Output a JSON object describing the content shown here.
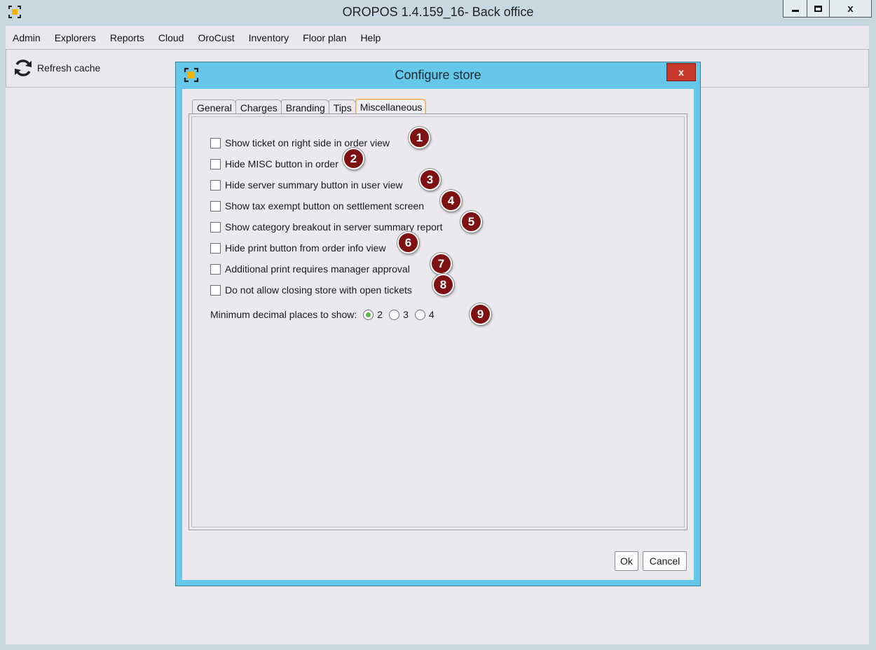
{
  "app": {
    "title": "OROPOS 1.4.159_16- Back office",
    "close_label": "x"
  },
  "menu": [
    "Admin",
    "Explorers",
    "Reports",
    "Cloud",
    "OroCust",
    "Inventory",
    "Floor plan",
    "Help"
  ],
  "toolbar": {
    "refresh_label": "Refresh cache"
  },
  "dialog": {
    "title": "Configure store",
    "close_label": "x",
    "tabs": [
      "General",
      "Charges",
      "Branding",
      "Tips",
      "Miscellaneous"
    ],
    "active_tab": "Miscellaneous",
    "options": [
      {
        "label": "Show ticket on right side in order view",
        "checked": false,
        "badge": "1"
      },
      {
        "label": "Hide MISC button in order",
        "checked": false,
        "badge": "2"
      },
      {
        "label": "Hide server summary button in user view",
        "checked": false,
        "badge": "3"
      },
      {
        "label": "Show tax exempt button on settlement screen",
        "checked": false,
        "badge": "4"
      },
      {
        "label": "Show category breakout in server summary report",
        "checked": false,
        "badge": "5"
      },
      {
        "label": "Hide print button from order info view",
        "checked": false,
        "badge": "6"
      },
      {
        "label": "Additional print requires manager approval",
        "checked": false,
        "badge": "7"
      },
      {
        "label": "Do not allow closing store with open tickets",
        "checked": false,
        "badge": "8"
      }
    ],
    "decimal": {
      "label": "Minimum decimal places to show:",
      "choices": [
        "2",
        "3",
        "4"
      ],
      "selected": "2",
      "badge": "9"
    },
    "ok_label": "Ok",
    "cancel_label": "Cancel"
  },
  "colors": {
    "dialog_frame": "#65c7ea",
    "badge": "#7e1212",
    "close_button": "#c8382b",
    "radio_selected": "#58b64a"
  }
}
